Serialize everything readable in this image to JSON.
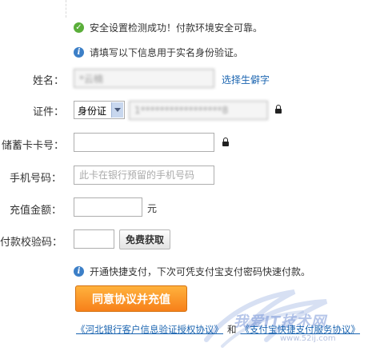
{
  "notices": {
    "security_ok": "安全设置检测成功！付款环境安全可靠。",
    "fill_info": "请填写以下信息用于实名身份验证。",
    "quick_pay": "开通快捷支付，下次可凭支付宝支付密码快速付款。"
  },
  "form": {
    "name_label": "姓名：",
    "name_value": "*云楠",
    "rare_char_link": "选择生僻字",
    "id_label": "证件：",
    "id_type": "身份证",
    "id_value": "1*****************8",
    "card_label": "储蓄卡卡号：",
    "card_value": "",
    "phone_label": "手机号码：",
    "phone_placeholder": "此卡在银行预留的手机号码",
    "amount_label": "充值金额：",
    "amount_unit": "元",
    "code_label": "付款校验码：",
    "get_code_button": "免费获取"
  },
  "submit_button": "同意协议并充值",
  "footer": {
    "agreement1": "《河北银行客户信息验证授权协议》",
    "and": "和",
    "agreement2": "《支付宝快捷支付服务协议》"
  },
  "watermark": {
    "text": "我爱IT技术网",
    "url": "www.52ij.com"
  },
  "colors": {
    "success": "#5aae3a",
    "info": "#3c7fc7",
    "link": "#1a64b0",
    "primary_button": "#f7801a"
  }
}
